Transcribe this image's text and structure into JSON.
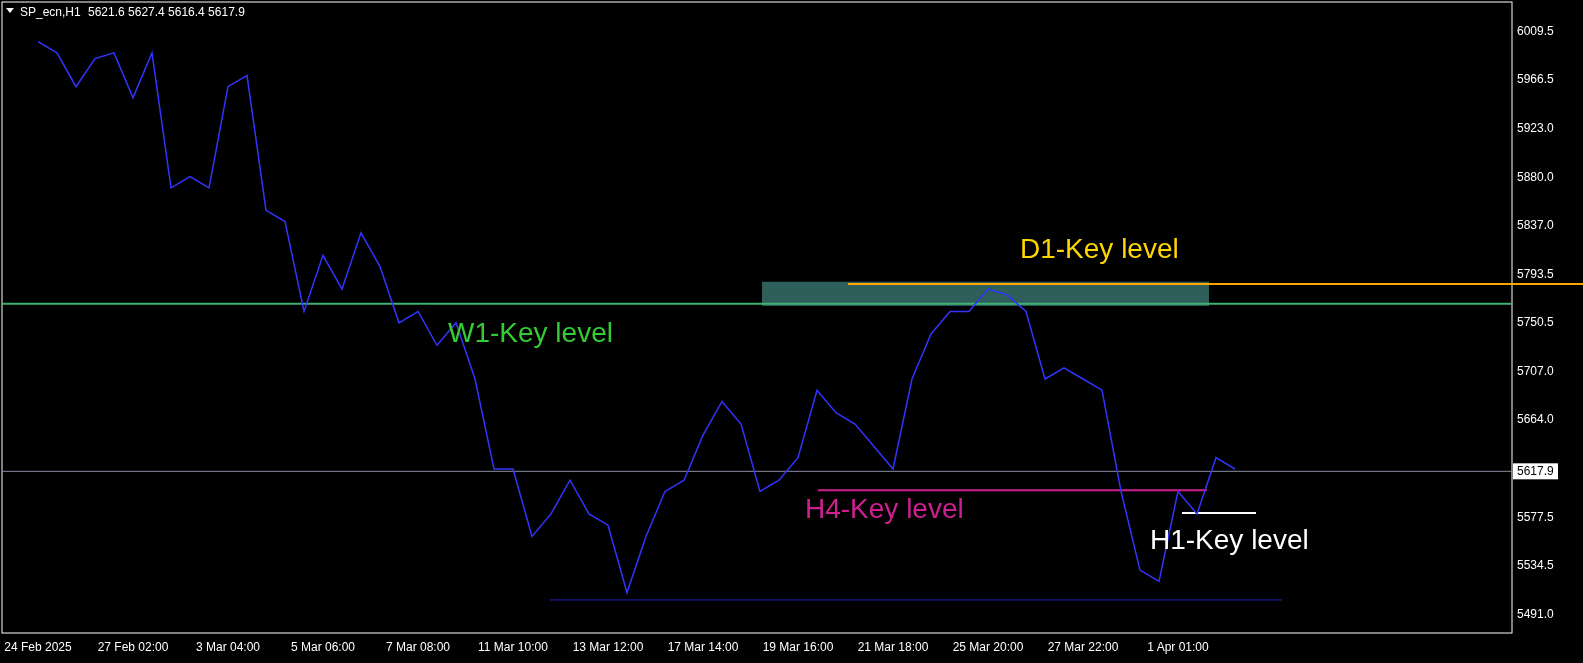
{
  "header": {
    "symbol": "SP_ecn,H1",
    "quote": "5621.6 5627.4 5616.4 5617.9"
  },
  "chart": {
    "current_price": "5617.9",
    "chart_data": {
      "type": "line",
      "ylim": [
        5474.1,
        6035.3
      ],
      "categories": [
        "24 Feb 2025",
        null,
        null,
        null,
        null,
        "27 Feb 02:00",
        null,
        null,
        null,
        null,
        "3 Mar 04:00",
        null,
        null,
        null,
        null,
        "5 Mar 06:00",
        null,
        null,
        null,
        null,
        "7 Mar 08:00",
        null,
        null,
        null,
        null,
        "11 Mar 10:00",
        null,
        null,
        null,
        null,
        "13 Mar 12:00",
        null,
        null,
        null,
        null,
        "17 Mar 14:00",
        null,
        null,
        null,
        null,
        "19 Mar 16:00",
        null,
        null,
        null,
        null,
        "21 Mar 18:00",
        null,
        null,
        null,
        null,
        "25 Mar 20:00",
        null,
        null,
        null,
        null,
        "27 Mar 22:00",
        null,
        null,
        null,
        null,
        "1 Apr 01:00",
        null,
        null,
        null
      ],
      "yticks": [
        {
          "value": 6009.5,
          "label": "6009.5"
        },
        {
          "value": 5966.5,
          "label": "5966.5"
        },
        {
          "value": 5923,
          "label": "5923.0"
        },
        {
          "value": 5880,
          "label": "5880.0"
        },
        {
          "value": 5837,
          "label": "5837.0"
        },
        {
          "value": 5793.5,
          "label": "5793.5"
        },
        {
          "value": 5750.5,
          "label": "5750.5"
        },
        {
          "value": 5707,
          "label": "5707.0"
        },
        {
          "value": 5664,
          "label": "5664.0"
        },
        {
          "value": 5577.5,
          "label": "5577.5"
        },
        {
          "value": 5534.5,
          "label": "5534.5"
        },
        {
          "value": 5491,
          "label": "5491.0"
        }
      ],
      "series": [
        {
          "color": "#3333ff",
          "values": [
            6000,
            5990,
            5960,
            5985,
            5990,
            5950,
            5990,
            5870,
            5880,
            5870,
            5960,
            5970,
            5850,
            5840,
            5760,
            5810,
            5780,
            5830,
            5800,
            5750,
            5760,
            5730,
            5750,
            5700,
            5620,
            5620,
            5560,
            5580,
            5610,
            5580,
            5570,
            5510,
            5560,
            5600,
            5610,
            5650,
            5680,
            5660,
            5600,
            5610,
            5630,
            5690,
            5670,
            5660,
            5640,
            5620,
            5700,
            5740,
            5760,
            5760,
            5780,
            5775,
            5760,
            5700,
            5710,
            5700,
            5690,
            5600,
            5530,
            5520,
            5600,
            5580,
            5630,
            5620
          ]
        }
      ],
      "ref_lines": [
        {
          "axis": "y",
          "value": 5784.6,
          "color": "#ffa500",
          "label": "D1-Key level"
        },
        {
          "axis": "y",
          "value": 5767,
          "color": "#3cb371",
          "label": "W1-Key level"
        },
        {
          "axis": "y",
          "value": 5601,
          "color": "#d02090",
          "label": "H4-Key level"
        },
        {
          "axis": "y",
          "value": 5580.8,
          "color": "#ffffff",
          "label": "H1-Key level"
        },
        {
          "axis": "y",
          "value": 5617.9,
          "color": "#8890a0"
        },
        {
          "axis": "y",
          "value": 5503.5,
          "color": "#2020c0"
        }
      ]
    }
  }
}
